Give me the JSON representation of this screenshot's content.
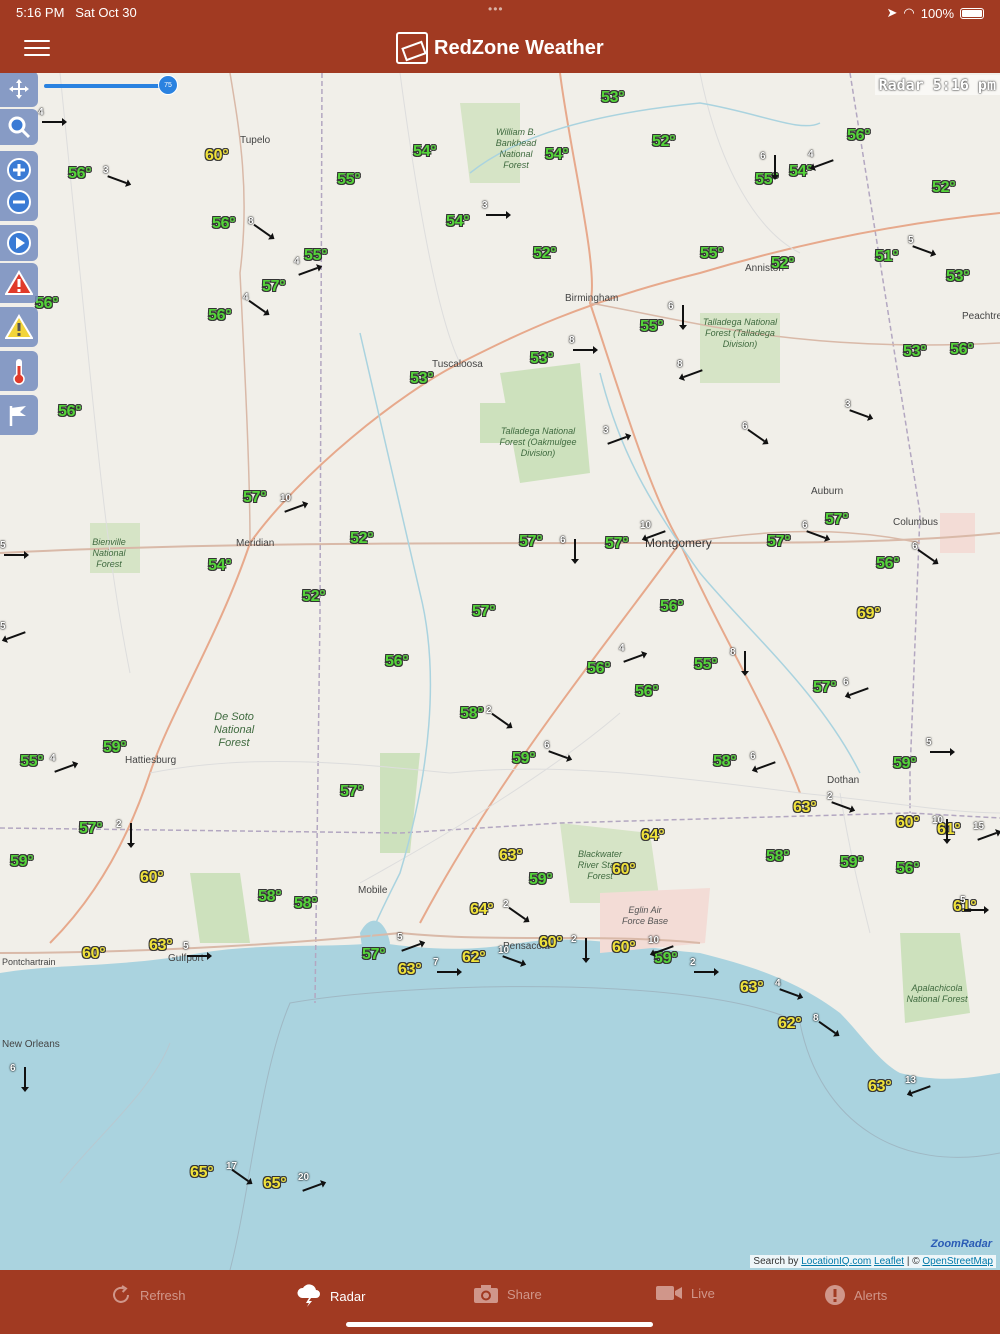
{
  "status": {
    "time": "5:16 PM",
    "date": "Sat Oct 30",
    "battery": "100%"
  },
  "header": {
    "title": "RedZone Weather"
  },
  "map": {
    "radar_label": "Radar 5:16 pm",
    "slider_value": "75",
    "attribution": {
      "search": "Search by",
      "provider": "LocationIQ.com",
      "leaflet": "Leaflet",
      "sep": "| ©",
      "osm": "OpenStreetMap"
    },
    "zoomradar": "ZoomRadar",
    "cities": [
      "Tupelo",
      "Birmingham",
      "Tuscaloosa",
      "Montgomery",
      "Meridian",
      "Hattiesburg",
      "Mobile",
      "Pensacola",
      "Gulfport",
      "Dothan",
      "Auburn",
      "Columbus",
      "Anniston",
      "Peachtree",
      "New Orleans",
      "Pontchartrain"
    ],
    "forests": [
      "William B. Bankhead National Forest",
      "Talladega National Forest (Oakmulgee Division)",
      "Talladega National Forest (Talladega Division)",
      "Bienville National Forest",
      "De Soto National Forest",
      "Blackwater River State Forest",
      "Eglin Air Force Base",
      "Apalachicola National Forest"
    ],
    "temps": [
      "60°",
      "56°",
      "56°",
      "56°",
      "56°",
      "56°",
      "54°",
      "55°",
      "54°",
      "53°",
      "54°",
      "52°",
      "52°",
      "55°",
      "54°",
      "56°",
      "52°",
      "55°",
      "52°",
      "51°",
      "53°",
      "53°",
      "56°",
      "55°",
      "57°",
      "57°",
      "52°",
      "54°",
      "52°",
      "53°",
      "55°",
      "53°",
      "57°",
      "57°",
      "57°",
      "57°",
      "57°",
      "56°",
      "56°",
      "56°",
      "55°",
      "57°",
      "56°",
      "69°",
      "56°",
      "58°",
      "59°",
      "58°",
      "59°",
      "55°",
      "59°",
      "57°",
      "57°",
      "63°",
      "59°",
      "60°",
      "58°",
      "58°",
      "64°",
      "60°",
      "58°",
      "59°",
      "59°",
      "60°",
      "61°",
      "56°",
      "61°",
      "60°",
      "63°",
      "64°",
      "63°",
      "62°",
      "57°",
      "60°",
      "60°",
      "59°",
      "63°",
      "62°",
      "63°",
      "65°",
      "65°",
      "63°",
      "63°",
      "58°",
      "64°",
      "58°"
    ],
    "winds": [
      "4",
      "3",
      "8",
      "10",
      "6",
      "4",
      "3",
      "5",
      "4",
      "4",
      "6",
      "8",
      "8",
      "3",
      "6",
      "3",
      "6",
      "10",
      "5",
      "6",
      "6",
      "4",
      "8",
      "6",
      "5",
      "6",
      "2",
      "4",
      "2",
      "6",
      "7",
      "10",
      "2",
      "5",
      "2",
      "10",
      "2",
      "4",
      "8",
      "15",
      "10",
      "13",
      "5",
      "2",
      "17",
      "20",
      "6",
      "5",
      "5"
    ]
  },
  "tabs": [
    {
      "label": "Refresh",
      "active": false
    },
    {
      "label": "Radar",
      "active": true
    },
    {
      "label": "Share",
      "active": false
    },
    {
      "label": "Live",
      "active": false
    },
    {
      "label": "Alerts",
      "active": false
    }
  ],
  "colors": {
    "header": "#a13a22",
    "temp_cool": "#55d43a",
    "temp_warm": "#f0e23a",
    "tool_bg": "#748cbe"
  }
}
